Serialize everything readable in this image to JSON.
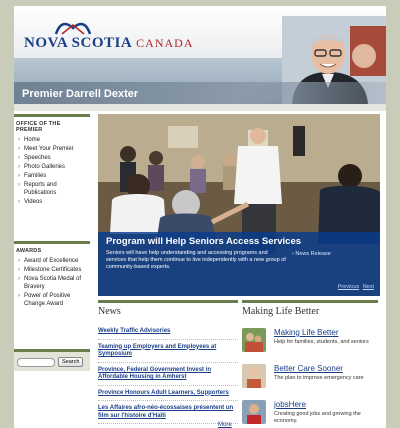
{
  "header": {
    "logo_main": "NOVA SCOTIA",
    "logo_sub": "CANADA",
    "premier_name": "Premier Darrell Dexter"
  },
  "sidebar": {
    "office_heading": "OFFICE OF THE PREMIER",
    "office_items": [
      "Home",
      "Meet Your Premier",
      "Speeches",
      "Photo Galleries",
      "Families",
      "Reports and Publications",
      "Videos"
    ],
    "awards_heading": "AWARDS",
    "awards_items": [
      "Award of Excellence",
      "Milestone Certificates",
      "Nova Scotia Medal of Bravery",
      "Power of Positive Change Award"
    ],
    "search_button": "Search"
  },
  "feature": {
    "title": "Program will Help Seniors Access Services",
    "text": "Seniors will have help understanding and accessing programs and services that help them continue to live independently with a new group of community-based experts.",
    "link": "News Release",
    "prev": "Previous",
    "next": "Next"
  },
  "news": {
    "heading": "News",
    "items": [
      "Weekly Traffic Advisories",
      "Teaming up Employers and Employees at Symposium",
      "Province, Federal Government Invest in Affordable Housing in Amherst",
      "Province Honours Adult Learners, Supporters",
      "Les Affaires afro-néo-écossaises présentent un film sur l'histoire d'Haïti"
    ],
    "more": "More"
  },
  "making_life_better": {
    "heading": "Making Life Better",
    "items": [
      {
        "title": "Making Life Better",
        "desc": "Help for families, students, and seniors"
      },
      {
        "title": "Better Care Sooner",
        "desc": "The plan to improve emergency care"
      },
      {
        "title": "jobsHere",
        "desc": "Creating good jobs and growing the economy."
      }
    ]
  },
  "colors": {
    "accent_green": "#6b7d4a",
    "link_blue": "#1a3f87",
    "caption_blue": "#083c8c"
  }
}
